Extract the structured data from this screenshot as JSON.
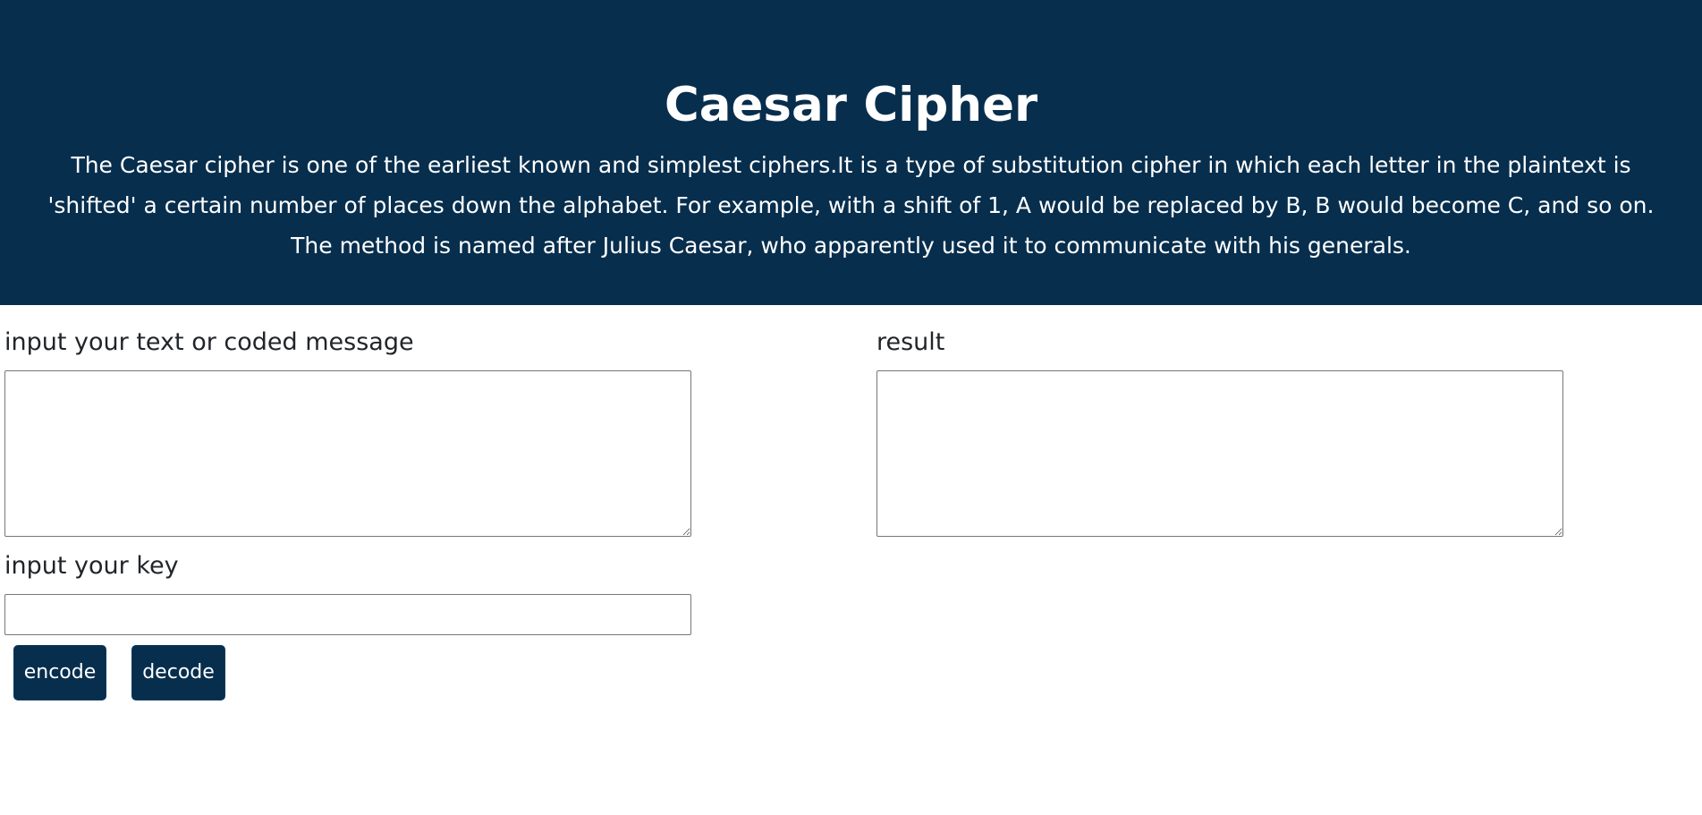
{
  "header": {
    "title": "Caesar Cipher",
    "description": "The Caesar cipher is one of the earliest known and simplest ciphers.It is a type of substitution cipher in which each letter in the plaintext is 'shifted' a certain number of places down the alphabet. For example, with a shift of 1, A would be replaced by B, B would become C, and so on. The method is named after Julius Caesar, who apparently used it to communicate with his generals."
  },
  "form": {
    "message_label": "input your text or coded message",
    "message_value": "",
    "result_label": "result",
    "result_value": "",
    "key_label": "input your key",
    "key_value": "",
    "encode_label": "encode",
    "decode_label": "decode"
  },
  "colors": {
    "header_background": "#072e4d",
    "button_background": "#072e4d",
    "header_text": "#ffffff"
  }
}
